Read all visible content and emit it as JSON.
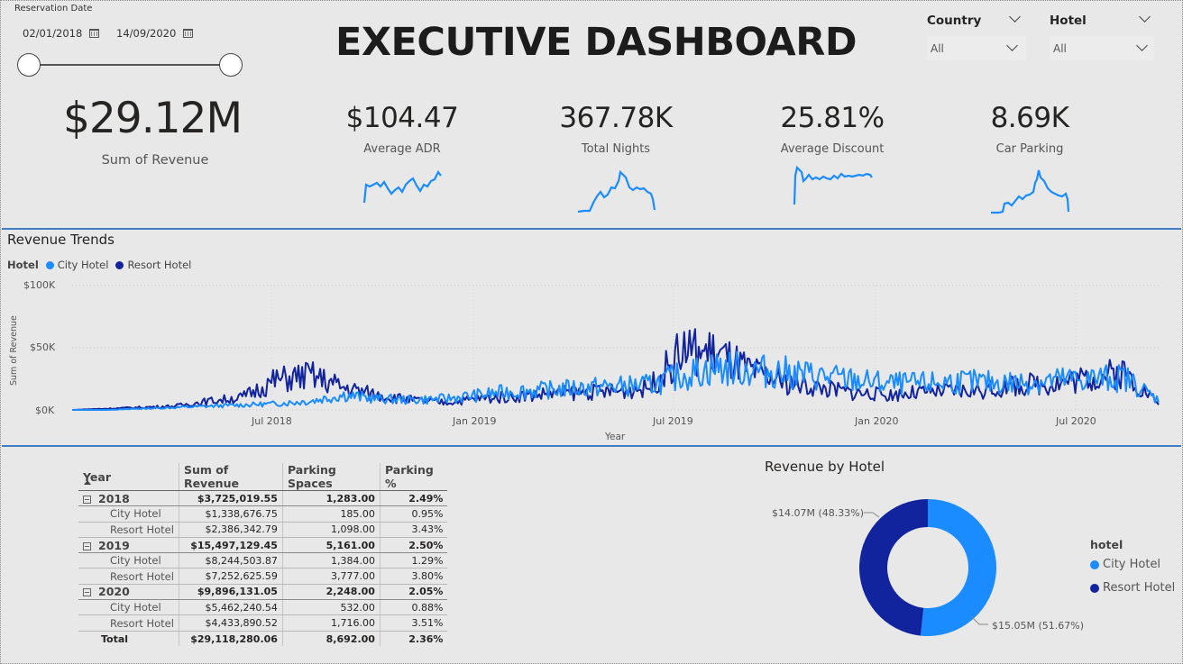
{
  "header": {
    "title": "EXECUTIVE DASHBOARD"
  },
  "date_slicer": {
    "label": "Reservation Date",
    "start": "02/01/2018",
    "end": "14/09/2020"
  },
  "filters": [
    {
      "label": "Country",
      "value": "All"
    },
    {
      "label": "Hotel",
      "value": "All"
    }
  ],
  "kpis": {
    "revenue": {
      "value": "$29.12M",
      "label": "Sum of Revenue"
    },
    "cards": [
      {
        "value": "$104.47",
        "label": "Average ADR"
      },
      {
        "value": "367.78K",
        "label": "Total Nights"
      },
      {
        "value": "25.81%",
        "label": "Average Discount"
      },
      {
        "value": "8.69K",
        "label": "Car Parking"
      }
    ]
  },
  "colors": {
    "city_hotel": "#1a8cff",
    "resort_hotel": "#12239e",
    "separator": "#3f7fc4"
  },
  "revenue_trends": {
    "title": "Revenue Trends",
    "legend_title": "Hotel",
    "y_axis_label": "Sum of Revenue",
    "x_axis_label": "Year",
    "y_ticks": [
      "$100K",
      "$50K",
      "$0K"
    ],
    "x_ticks": [
      "Jul 2018",
      "Jan 2019",
      "Jul 2019",
      "Jan 2020",
      "Jul 2020"
    ]
  },
  "matrix": {
    "headers": [
      "Year",
      "Sum of Revenue",
      "Parking Spaces",
      "Parking %"
    ],
    "rows": [
      {
        "type": "grp",
        "label": "2018",
        "revenue": "$3,725,019.55",
        "parking": "1,283.00",
        "pct": "2.49%"
      },
      {
        "type": "sub",
        "label": "City Hotel",
        "revenue": "$1,338,676.75",
        "parking": "185.00",
        "pct": "0.95%"
      },
      {
        "type": "sub",
        "label": "Resort Hotel",
        "revenue": "$2,386,342.79",
        "parking": "1,098.00",
        "pct": "3.43%"
      },
      {
        "type": "grp",
        "label": "2019",
        "revenue": "$15,497,129.45",
        "parking": "5,161.00",
        "pct": "2.50%"
      },
      {
        "type": "sub",
        "label": "City Hotel",
        "revenue": "$8,244,503.87",
        "parking": "1,384.00",
        "pct": "1.29%"
      },
      {
        "type": "sub",
        "label": "Resort Hotel",
        "revenue": "$7,252,625.59",
        "parking": "3,777.00",
        "pct": "3.80%"
      },
      {
        "type": "grp",
        "label": "2020",
        "revenue": "$9,896,131.05",
        "parking": "2,248.00",
        "pct": "2.05%"
      },
      {
        "type": "sub",
        "label": "City Hotel",
        "revenue": "$5,462,240.54",
        "parking": "532.00",
        "pct": "0.88%"
      },
      {
        "type": "sub",
        "label": "Resort Hotel",
        "revenue": "$4,433,890.52",
        "parking": "1,716.00",
        "pct": "3.51%"
      },
      {
        "type": "tot",
        "label": "Total",
        "revenue": "$29,118,280.06",
        "parking": "8,692.00",
        "pct": "2.36%"
      }
    ]
  },
  "revenue_by_hotel": {
    "title": "Revenue by Hotel",
    "legend_title": "hotel",
    "slices": [
      {
        "name": "City Hotel",
        "label": "$15.05M (51.67%)",
        "pct": 51.67
      },
      {
        "name": "Resort Hotel",
        "label": "$14.07M (48.33%)",
        "pct": 48.33
      }
    ]
  },
  "chart_data": [
    {
      "type": "line",
      "title": "Revenue Trends",
      "xlabel": "Year",
      "ylabel": "Sum of Revenue",
      "ylim": [
        0,
        100000
      ],
      "x": [
        "2018-01",
        "2018-02",
        "2018-03",
        "2018-04",
        "2018-05",
        "2018-06",
        "2018-07",
        "2018-08",
        "2018-09",
        "2018-10",
        "2018-11",
        "2018-12",
        "2019-01",
        "2019-02",
        "2019-03",
        "2019-04",
        "2019-05",
        "2019-06",
        "2019-07",
        "2019-08",
        "2019-09",
        "2019-10",
        "2019-11",
        "2019-12",
        "2020-01",
        "2020-02",
        "2020-03",
        "2020-04",
        "2020-05",
        "2020-06",
        "2020-07",
        "2020-08",
        "2020-09"
      ],
      "series": [
        {
          "name": "City Hotel",
          "values": [
            0,
            0,
            1000,
            2000,
            3000,
            4000,
            5000,
            7000,
            12000,
            9000,
            8000,
            9000,
            12000,
            15000,
            16000,
            18000,
            19000,
            20000,
            28000,
            34000,
            32000,
            30000,
            27000,
            24000,
            21000,
            21000,
            23000,
            22000,
            22000,
            24000,
            25000,
            26000,
            8000
          ]
        },
        {
          "name": "Resort Hotel",
          "values": [
            0,
            1000,
            2000,
            3000,
            7000,
            10000,
            24000,
            28000,
            18000,
            12000,
            8000,
            6000,
            9000,
            11000,
            13000,
            14000,
            15000,
            18000,
            48000,
            45000,
            30000,
            22000,
            18000,
            14000,
            12000,
            14000,
            15000,
            16000,
            20000,
            22000,
            26000,
            30000,
            5000
          ]
        }
      ],
      "grid": true,
      "legend": "top-left"
    },
    {
      "type": "pie",
      "title": "Revenue by Hotel",
      "categories": [
        "City Hotel",
        "Resort Hotel"
      ],
      "values": [
        15.05,
        14.07
      ],
      "legend": "right"
    }
  ]
}
